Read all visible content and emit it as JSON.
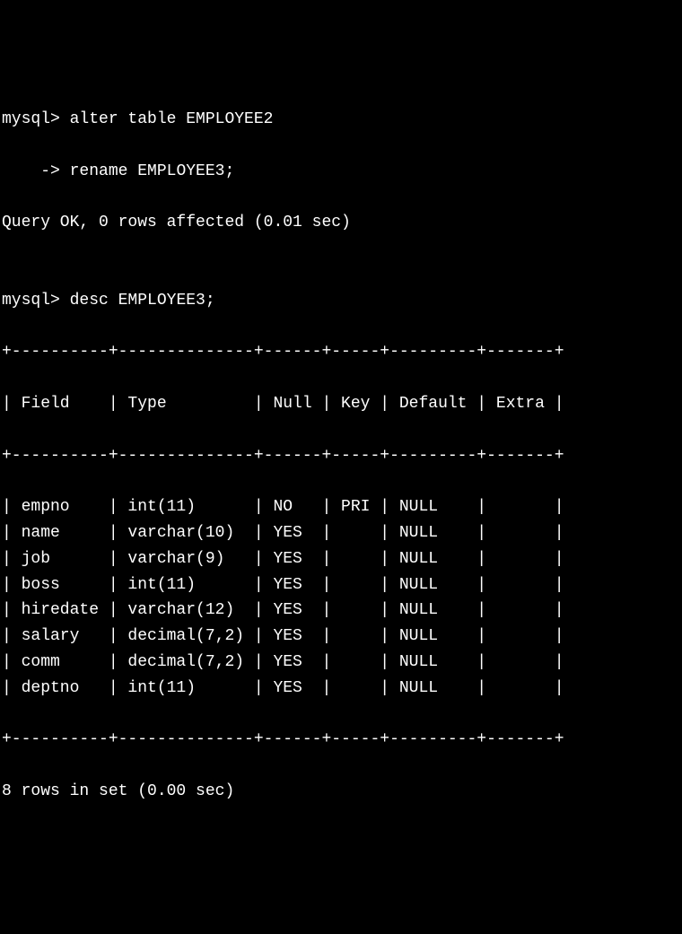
{
  "session": {
    "prompt1": "mysql>",
    "arrow_prompt": "    ->",
    "cmd1_line1": "alter table EMPLOYEE2",
    "cmd1_line2": "rename EMPLOYEE3;",
    "result1": "Query OK, 0 rows affected (0.01 sec)",
    "blank": "",
    "cmd2": "desc EMPLOYEE3;",
    "footer": "8 rows in set (0.00 sec)"
  },
  "table": {
    "border_top": "+----------+--------------+------+-----+---------+-------+",
    "border_mid": "+----------+--------------+------+-----+---------+-------+",
    "border_bottom": "+----------+--------------+------+-----+---------+-------+",
    "header": {
      "field": "Field",
      "type": "Type",
      "null": "Null",
      "key": "Key",
      "default": "Default",
      "extra": "Extra"
    },
    "rows": [
      {
        "field": "empno",
        "type": "int(11)",
        "null": "NO",
        "key": "PRI",
        "default": "NULL",
        "extra": ""
      },
      {
        "field": "name",
        "type": "varchar(10)",
        "null": "YES",
        "key": "",
        "default": "NULL",
        "extra": ""
      },
      {
        "field": "job",
        "type": "varchar(9)",
        "null": "YES",
        "key": "",
        "default": "NULL",
        "extra": ""
      },
      {
        "field": "boss",
        "type": "int(11)",
        "null": "YES",
        "key": "",
        "default": "NULL",
        "extra": ""
      },
      {
        "field": "hiredate",
        "type": "varchar(12)",
        "null": "YES",
        "key": "",
        "default": "NULL",
        "extra": ""
      },
      {
        "field": "salary",
        "type": "decimal(7,2)",
        "null": "YES",
        "key": "",
        "default": "NULL",
        "extra": ""
      },
      {
        "field": "comm",
        "type": "decimal(7,2)",
        "null": "YES",
        "key": "",
        "default": "NULL",
        "extra": ""
      },
      {
        "field": "deptno",
        "type": "int(11)",
        "null": "YES",
        "key": "",
        "default": "NULL",
        "extra": ""
      }
    ],
    "col_widths": {
      "field": 8,
      "type": 12,
      "null": 4,
      "key": 3,
      "default": 7,
      "extra": 5
    }
  }
}
